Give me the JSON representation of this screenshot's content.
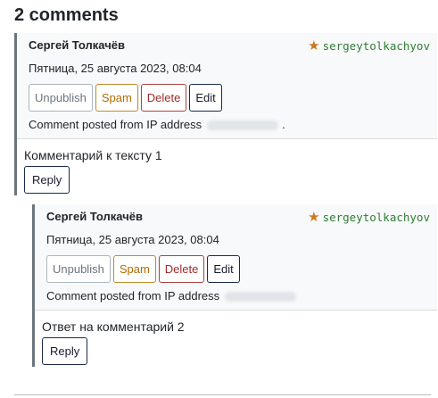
{
  "heading": "2 comments",
  "comments": [
    {
      "author": "Сергей Толкачёв",
      "username": "sergeytolkachyov",
      "date": "Пятница, 25 августа 2023, 08:04",
      "actions": {
        "unpublish": "Unpublish",
        "spam": "Spam",
        "delete": "Delete",
        "edit": "Edit"
      },
      "ip_label": "Comment posted from IP address",
      "ip_suffix": ".",
      "text": "Комментарий к тексту 1",
      "reply": "Reply"
    },
    {
      "author": "Сергей Толкачёв",
      "username": "sergeytolkachyov",
      "date": "Пятница, 25 августа 2023, 08:04",
      "actions": {
        "unpublish": "Unpublish",
        "spam": "Spam",
        "delete": "Delete",
        "edit": "Edit"
      },
      "ip_label": "Comment posted from IP address",
      "ip_suffix": "",
      "text": "Ответ на комментарий 2",
      "reply": "Reply"
    }
  ],
  "icons": {
    "author_badge": "star-icon"
  },
  "colors": {
    "username": "#2e7d32",
    "star": "#c97a17",
    "delete": "#a02b2b",
    "spam": "#b36b00",
    "comment_border": "#6c757d"
  }
}
